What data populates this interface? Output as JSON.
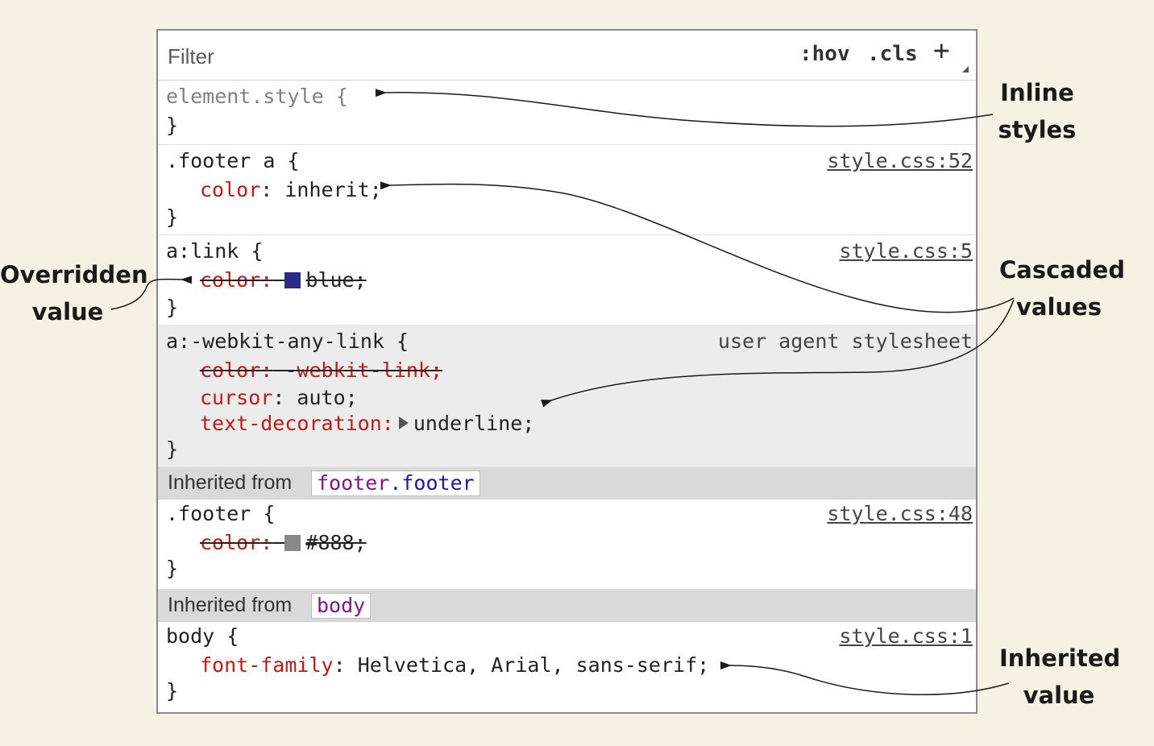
{
  "toolbar": {
    "filter_placeholder": "Filter",
    "hov_label": ":hov",
    "cls_label": ".cls",
    "add_label": "+"
  },
  "rules": [
    {
      "selector": "element.style {",
      "close": "}",
      "source": ""
    },
    {
      "selector": ".footer a {",
      "close": "}",
      "source": "style.css:52",
      "decls": [
        {
          "prop": "color",
          "colon": ":",
          "value": " inherit;"
        }
      ]
    },
    {
      "selector": "a:link {",
      "close": "}",
      "source": "style.css:5",
      "decls": [
        {
          "prop": "color",
          "colon": ":",
          "value": "blue;",
          "swatch": "#2e2a8a",
          "overridden": true
        }
      ]
    },
    {
      "selector": "a:-webkit-any-link {",
      "close": "}",
      "source": "user agent stylesheet",
      "decls": [
        {
          "prop": "color",
          "colon": ":",
          "value": " -webkit-link;",
          "overridden": true
        },
        {
          "prop": "cursor",
          "colon": ":",
          "value": " auto;"
        },
        {
          "prop": "text-decoration",
          "colon": ":",
          "value": "underline;"
        }
      ]
    },
    {
      "selector": ".footer {",
      "close": "}",
      "source": "style.css:48",
      "decls": [
        {
          "prop": "color",
          "colon": ":",
          "value": "#888;",
          "swatch": "#888888",
          "overridden": true
        }
      ]
    },
    {
      "selector": "body {",
      "close": "}",
      "source": "style.css:1",
      "decls": [
        {
          "prop": "font-family",
          "colon": ":",
          "value": " Helvetica, Arial, sans-serif;"
        }
      ]
    }
  ],
  "inherited": [
    {
      "label": "Inherited from",
      "node_tag": "footer",
      "node_class": ".footer"
    },
    {
      "label": "Inherited from",
      "node_tag": "body"
    }
  ],
  "annotations": {
    "inline_styles": [
      "Inline",
      "styles"
    ],
    "overridden_value": [
      "Overridden",
      "value"
    ],
    "cascaded_values": [
      "Cascaded",
      "values"
    ],
    "inherited_value": [
      "Inherited",
      "value"
    ]
  },
  "colors": {
    "property": "#c41a16",
    "node": "#881391",
    "background": "#f6f1e3"
  }
}
